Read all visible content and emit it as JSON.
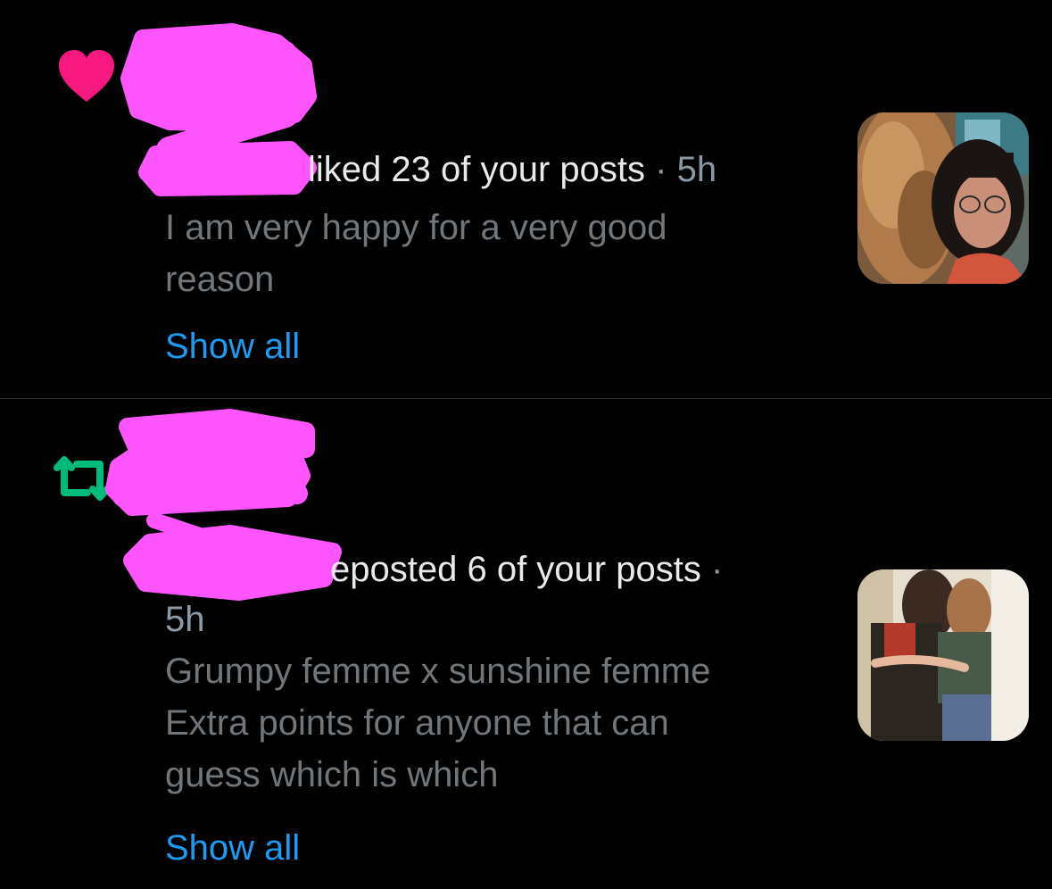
{
  "colors": {
    "background": "#000000",
    "divider": "#2f3336",
    "heart": "#f91880",
    "repost": "#00ba7c",
    "link": "#1d9bf0",
    "redaction": "#ff55ff"
  },
  "notifications": [
    {
      "type_icon": "heart-icon",
      "headline": {
        "action_text": "liked 23 of your posts",
        "separator": "·",
        "time": "5h"
      },
      "post_snippet": [
        "I am very happy for a very good",
        "reason"
      ],
      "show_all_label": "Show all",
      "thumbnail": "photo-thumbnail"
    },
    {
      "type_icon": "repost-icon",
      "headline": {
        "action_text": "eposted 6 of your posts",
        "separator": "·",
        "time": "5h"
      },
      "post_snippet": [
        "Grumpy femme x sunshine femme",
        "Extra points for anyone that can",
        "guess which is which"
      ],
      "show_all_label": "Show all",
      "thumbnail": "photo-thumbnail"
    }
  ]
}
